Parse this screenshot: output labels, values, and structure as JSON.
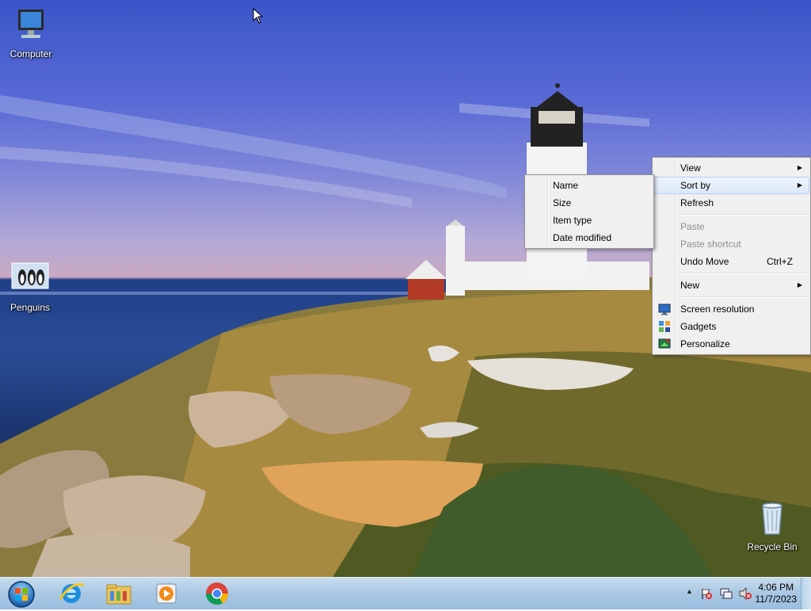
{
  "desktop": {
    "icons": [
      {
        "label": "Computer"
      },
      {
        "label": "Penguins"
      },
      {
        "label": "Recycle Bin"
      }
    ]
  },
  "context_menu": {
    "items": [
      {
        "label": "View",
        "submenu": true
      },
      {
        "label": "Sort by",
        "submenu": true,
        "highlighted": true
      },
      {
        "label": "Refresh"
      },
      {
        "label": "Paste",
        "disabled": true
      },
      {
        "label": "Paste shortcut",
        "disabled": true
      },
      {
        "label": "Undo Move",
        "accelerator": "Ctrl+Z"
      },
      {
        "label": "New",
        "submenu": true
      },
      {
        "label": "Screen resolution",
        "icon": "screen-resolution-icon"
      },
      {
        "label": "Gadgets",
        "icon": "gadgets-icon"
      },
      {
        "label": "Personalize",
        "icon": "personalize-icon"
      }
    ]
  },
  "sort_submenu": {
    "items": [
      {
        "label": "Name"
      },
      {
        "label": "Size"
      },
      {
        "label": "Item type"
      },
      {
        "label": "Date modified"
      }
    ]
  },
  "taskbar": {
    "pinned": [
      {
        "icon": "start-orb-icon"
      },
      {
        "icon": "internet-explorer-icon"
      },
      {
        "icon": "file-explorer-icon"
      },
      {
        "icon": "media-player-icon"
      },
      {
        "icon": "chrome-icon"
      }
    ],
    "clock": {
      "time": "4:06 PM",
      "date": "11/7/2023"
    }
  },
  "colors": {
    "taskbar": "#a9c7e3",
    "menu_bg": "#f0f0f0",
    "menu_highlight": "#dce9f8"
  }
}
